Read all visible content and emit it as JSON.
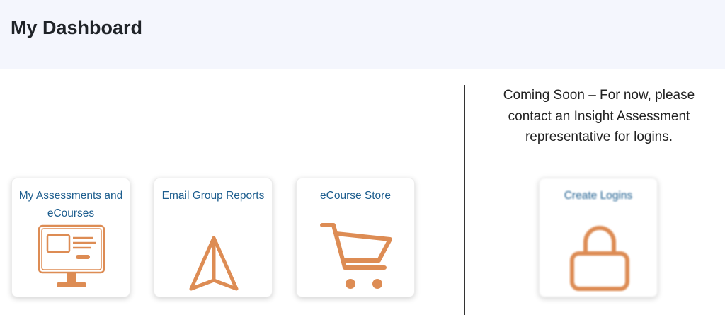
{
  "header": {
    "title": "My Dashboard"
  },
  "cards": [
    {
      "label": "My Assessments and eCourses",
      "icon": "monitor-icon"
    },
    {
      "label": "Email Group Reports",
      "icon": "send-icon"
    },
    {
      "label": "eCourse Store",
      "icon": "shopping-cart-icon"
    }
  ],
  "right_panel": {
    "message": "Coming Soon – For now, please contact an Insight Assessment representative for logins.",
    "card": {
      "label": "Create Logins",
      "icon": "lock-icon",
      "disabled": true
    }
  },
  "colors": {
    "icon": "#dd8c54",
    "link": "#1c5d8e",
    "header_bg": "#f4f6fd"
  }
}
